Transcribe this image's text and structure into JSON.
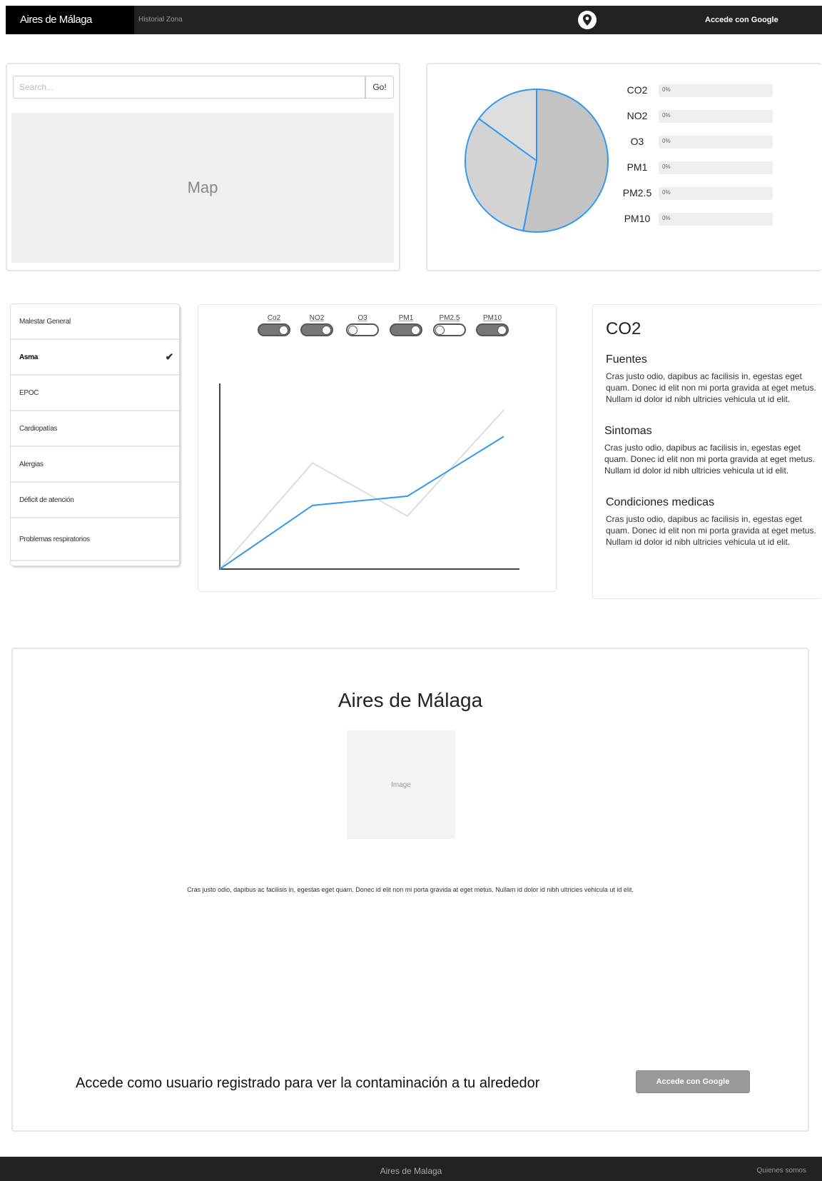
{
  "navbar": {
    "brand": "Aires de Málaga",
    "link": "Historial Zona",
    "login": "Accede con Google"
  },
  "search": {
    "placeholder": "Search...",
    "button": "Go!"
  },
  "map": {
    "label": "Map"
  },
  "pollutants": {
    "items": [
      {
        "label": "CO2",
        "value": "0%"
      },
      {
        "label": "NO2",
        "value": "0%"
      },
      {
        "label": "O3",
        "value": "0%"
      },
      {
        "label": "PM1",
        "value": "0%"
      },
      {
        "label": "PM2.5",
        "value": "0%"
      },
      {
        "label": "PM10",
        "value": "0%"
      }
    ]
  },
  "pie": {
    "slices": [
      {
        "fraction": 0.53,
        "color": "#c3c3c3"
      },
      {
        "fraction": 0.32,
        "color": "#d3d3d3"
      },
      {
        "fraction": 0.15,
        "color": "#dedede"
      }
    ],
    "stroke": "#3399ee"
  },
  "conditions": {
    "items": [
      {
        "label": "Malestar General",
        "active": false
      },
      {
        "label": "Asma",
        "active": true
      },
      {
        "label": "EPOC",
        "active": false
      },
      {
        "label": "Cardiopatías",
        "active": false
      },
      {
        "label": "Alergias",
        "active": false
      },
      {
        "label": "Déficit de atención",
        "active": false
      },
      {
        "label": "Problemas respiratorios",
        "active": false
      }
    ]
  },
  "toggles": [
    {
      "label": "Co2",
      "on": true
    },
    {
      "label": "NO2",
      "on": true
    },
    {
      "label": "O3",
      "on": false
    },
    {
      "label": "PM1",
      "on": true
    },
    {
      "label": "PM2.5",
      "on": false
    },
    {
      "label": "PM10",
      "on": true
    }
  ],
  "line_chart": {
    "series": [
      {
        "color": "#3399ee",
        "values": [
          0,
          48,
          55,
          100
        ]
      },
      {
        "color": "#dddddd",
        "values": [
          0,
          80,
          40,
          120
        ]
      }
    ],
    "axis_color": "#444444"
  },
  "info": {
    "title": "CO2",
    "sections": [
      {
        "heading": "Fuentes",
        "text": "Cras justo odio, dapibus ac facilisis in, egestas eget quam. Donec id elit non mi porta gravida at eget metus. Nullam id dolor id nibh ultricies vehicula ut id elit."
      },
      {
        "heading": "Sintomas",
        "text": "Cras justo odio, dapibus ac facilisis in, egestas eget quam. Donec id elit non mi porta gravida at eget metus. Nullam id dolor id nibh ultricies vehicula ut id elit."
      },
      {
        "heading": "Condiciones medicas",
        "text": "Cras justo odio, dapibus ac facilisis in, egestas eget quam. Donec id elit non mi porta gravida at eget metus. Nullam id dolor id nibh ultricies vehicula ut id elit."
      }
    ]
  },
  "about": {
    "title": "Aires de Málaga",
    "image_label": "Image",
    "text": "Cras justo odio, dapibus ac facilisis in, egestas eget quam. Donec id elit non mi porta gravida at eget metus. Nullam id dolor id nibh ultricies vehicula ut id elit.",
    "cta": "Accede como usuario registrado para ver la contaminación a tu alrededor",
    "button": "Accede con Google"
  },
  "footer": {
    "brand": "Aires de Malaga",
    "link": "Quienes somos"
  }
}
